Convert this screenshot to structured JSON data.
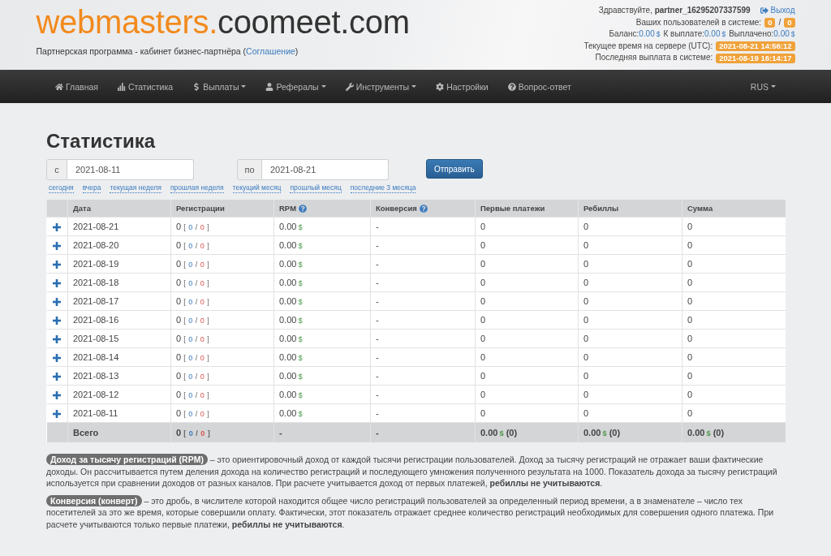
{
  "header": {
    "logo": {
      "primary": "webmasters.",
      "secondary": "coomeet.com"
    },
    "tagline": {
      "text": "Партнерская программа - кабинет бизнес-партнёра (",
      "link": "Соглашение",
      "close": ")"
    },
    "user": {
      "greeting": "Здравствуйте, **partner_16295207337599**",
      "logout": "Выход"
    },
    "users_in_system": {
      "label": "Ваших пользователей в системе:",
      "values": [
        "0",
        "0"
      ],
      "separator": "/"
    },
    "balances": [
      {
        "label": "Баланс:",
        "value": "0.00",
        "currency": "$"
      },
      {
        "label": "К выплате:",
        "value": "0.00",
        "currency": "$"
      },
      {
        "label": "Выплачено:",
        "value": "0.00",
        "currency": "$"
      }
    ],
    "server_time": {
      "label": "Текущее время на сервере (UTC):",
      "value": "2021-08-21 14:56:12"
    },
    "last_payout": {
      "label": "Последняя выплата в системе:",
      "value": "2021-08-19 16:14:17"
    }
  },
  "nav": {
    "items": [
      {
        "label": "Главная",
        "kind": "home",
        "dropdown": false
      },
      {
        "label": "Статистика",
        "kind": "stats",
        "dropdown": false
      },
      {
        "label": "Выплаты",
        "kind": "dollar",
        "dropdown": true
      },
      {
        "label": "Рефералы",
        "kind": "user",
        "dropdown": true
      },
      {
        "label": "Инструменты",
        "kind": "wrench",
        "dropdown": true
      },
      {
        "label": "Настройки",
        "kind": "gear",
        "dropdown": false
      },
      {
        "label": "Вопрос-ответ",
        "kind": "question",
        "dropdown": false
      }
    ],
    "language": {
      "label": "RUS",
      "dropdown": true
    }
  },
  "page_title": "Статистика",
  "date_filter": {
    "from": {
      "addon": "с",
      "value": "2021-08-11"
    },
    "to": {
      "addon": "по",
      "value": "2021-08-21"
    },
    "submit": "Отправить",
    "shortcuts": [
      "сегодня",
      "вчера",
      "текущая неделя",
      "прошлая неделя",
      "текущий месяц",
      "прошлый месяц",
      "последние 3 месяца"
    ]
  },
  "table": {
    "columns": [
      {
        "label": "Дата",
        "help": false
      },
      {
        "label": "Регистрации",
        "help": false
      },
      {
        "label": "RPM",
        "help": true
      },
      {
        "label": "Конверсия",
        "help": true
      },
      {
        "label": "Первые платежи",
        "help": false
      },
      {
        "label": "Ребиллы",
        "help": false
      },
      {
        "label": "Сумма",
        "help": false
      }
    ],
    "rows": [
      {
        "expanded": false,
        "date": "2021-08-21",
        "registrations": {
          "total": "0",
          "open": "[",
          "first": "0",
          "slash": "/",
          "second": "0",
          "close": "]"
        },
        "rpm": {
          "value": "0.00",
          "currency": "$"
        },
        "conversion": "-",
        "first_payments": "0",
        "rebills": "0",
        "sum": "0"
      },
      {
        "expanded": false,
        "date": "2021-08-20",
        "registrations": {
          "total": "0",
          "open": "[",
          "first": "0",
          "slash": "/",
          "second": "0",
          "close": "]"
        },
        "rpm": {
          "value": "0.00",
          "currency": "$"
        },
        "conversion": "-",
        "first_payments": "0",
        "rebills": "0",
        "sum": "0"
      },
      {
        "expanded": false,
        "date": "2021-08-19",
        "registrations": {
          "total": "0",
          "open": "[",
          "first": "0",
          "slash": "/",
          "second": "0",
          "close": "]"
        },
        "rpm": {
          "value": "0.00",
          "currency": "$"
        },
        "conversion": "-",
        "first_payments": "0",
        "rebills": "0",
        "sum": "0"
      },
      {
        "expanded": false,
        "date": "2021-08-18",
        "registrations": {
          "total": "0",
          "open": "[",
          "first": "0",
          "slash": "/",
          "second": "0",
          "close": "]"
        },
        "rpm": {
          "value": "0.00",
          "currency": "$"
        },
        "conversion": "-",
        "first_payments": "0",
        "rebills": "0",
        "sum": "0"
      },
      {
        "expanded": false,
        "date": "2021-08-17",
        "registrations": {
          "total": "0",
          "open": "[",
          "first": "0",
          "slash": "/",
          "second": "0",
          "close": "]"
        },
        "rpm": {
          "value": "0.00",
          "currency": "$"
        },
        "conversion": "-",
        "first_payments": "0",
        "rebills": "0",
        "sum": "0"
      },
      {
        "expanded": false,
        "date": "2021-08-16",
        "registrations": {
          "total": "0",
          "open": "[",
          "first": "0",
          "slash": "/",
          "second": "0",
          "close": "]"
        },
        "rpm": {
          "value": "0.00",
          "currency": "$"
        },
        "conversion": "-",
        "first_payments": "0",
        "rebills": "0",
        "sum": "0"
      },
      {
        "expanded": false,
        "date": "2021-08-15",
        "registrations": {
          "total": "0",
          "open": "[",
          "first": "0",
          "slash": "/",
          "second": "0",
          "close": "]"
        },
        "rpm": {
          "value": "0.00",
          "currency": "$"
        },
        "conversion": "-",
        "first_payments": "0",
        "rebills": "0",
        "sum": "0"
      },
      {
        "expanded": false,
        "date": "2021-08-14",
        "registrations": {
          "total": "0",
          "open": "[",
          "first": "0",
          "slash": "/",
          "second": "0",
          "close": "]"
        },
        "rpm": {
          "value": "0.00",
          "currency": "$"
        },
        "conversion": "-",
        "first_payments": "0",
        "rebills": "0",
        "sum": "0"
      },
      {
        "expanded": false,
        "date": "2021-08-13",
        "registrations": {
          "total": "0",
          "open": "[",
          "first": "0",
          "slash": "/",
          "second": "0",
          "close": "]"
        },
        "rpm": {
          "value": "0.00",
          "currency": "$"
        },
        "conversion": "-",
        "first_payments": "0",
        "rebills": "0",
        "sum": "0"
      },
      {
        "expanded": false,
        "date": "2021-08-12",
        "registrations": {
          "total": "0",
          "open": "[",
          "first": "0",
          "slash": "/",
          "second": "0",
          "close": "]"
        },
        "rpm": {
          "value": "0.00",
          "currency": "$"
        },
        "conversion": "-",
        "first_payments": "0",
        "rebills": "0",
        "sum": "0"
      },
      {
        "expanded": false,
        "date": "2021-08-11",
        "registrations": {
          "total": "0",
          "open": "[",
          "first": "0",
          "slash": "/",
          "second": "0",
          "close": "]"
        },
        "rpm": {
          "value": "0.00",
          "currency": "$"
        },
        "conversion": "-",
        "first_payments": "0",
        "rebills": "0",
        "sum": "0"
      }
    ],
    "total": {
      "label": "Всего",
      "registrations": {
        "total": "0",
        "open": "[",
        "first": "0",
        "slash": "/",
        "second": "0",
        "close": "]"
      },
      "rpm": "-",
      "conversion": "-",
      "first_payments": {
        "value": "0.00",
        "currency": "$",
        "count": "(0)"
      },
      "rebills": {
        "value": "0.00",
        "currency": "$",
        "count": "(0)"
      },
      "sum": {
        "value": "0.00",
        "currency": "$",
        "count": "(0)"
      }
    }
  },
  "notes": [
    {
      "term": "Доход за тысячу регистраций (RPM)",
      "text": "– это ориентировочный доход от каждой тысячи регистрации пользователей. Доход за тысячу регистраций не отражает ваши фактические доходы. Он рассчитывается путем деления дохода на количество регистраций и последующего умножения полученного результата на 1000. Показатель дохода за тысячу регистраций используется при сравнении доходов от разных каналов. При расчете учитывается доход от первых платежей, **ребиллы не учитываются**."
    },
    {
      "term": "Конверсия (конверт)",
      "text": "– это дробь, в числителе которой находится общее число регистраций пользователей за определенный период времени, а в знаменателе – число тех посетителей за это же время, которые совершили оплату. Фактически, этот показатель отражает среднее количество регистраций необходимых для совершения одного платежа. При расчете учитываются только первые платежи, **ребиллы не учитываются**."
    }
  ]
}
